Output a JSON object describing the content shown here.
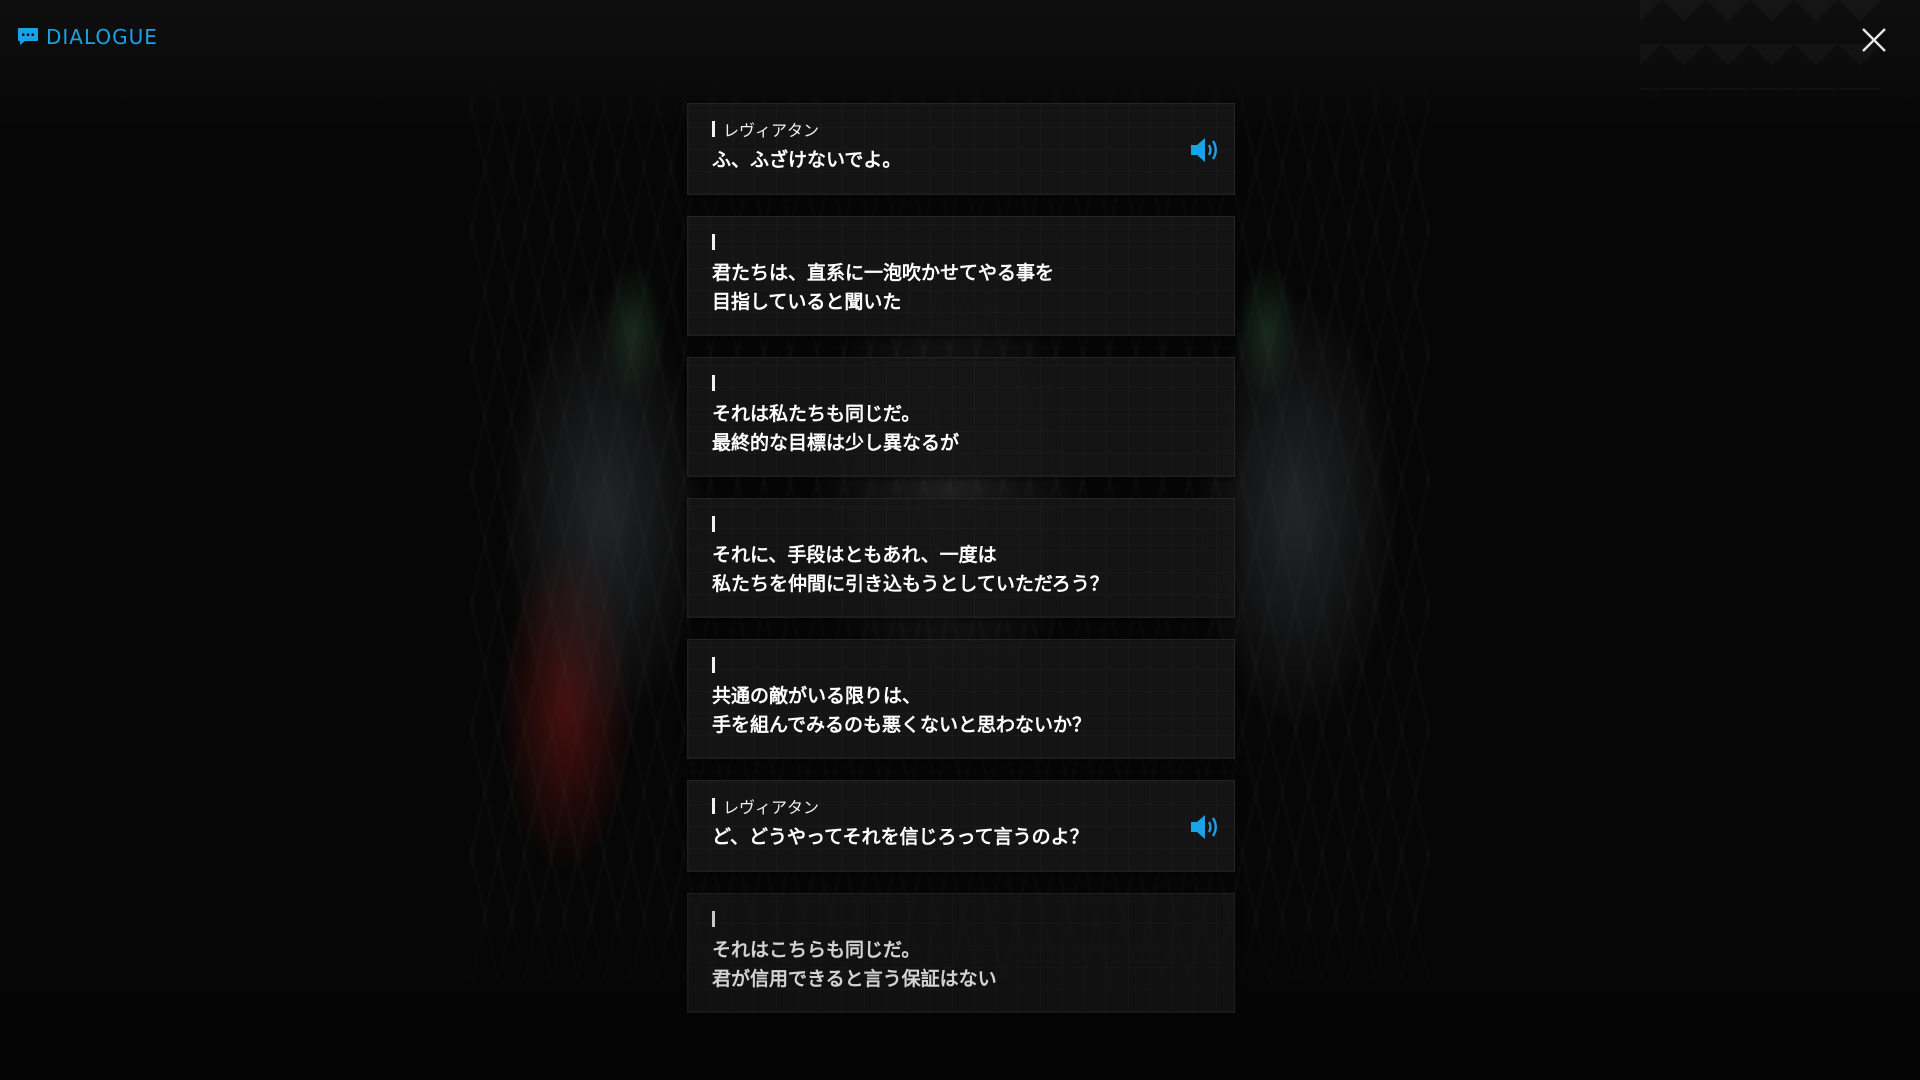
{
  "header": {
    "title": "DIALOGUE",
    "icon": "chat-bubble-icon",
    "close_icon": "close-icon"
  },
  "colors": {
    "accent": "#1aa2e6",
    "card_bg": "#161617",
    "text": "#ffffff",
    "page_bg": "#060606"
  },
  "dialogue": [
    {
      "speaker": "レヴィアタン",
      "lines": [
        "ふ、ふざけないでよ。"
      ],
      "voice": true
    },
    {
      "speaker": "",
      "lines": [
        "君たちは、直系に一泡吹かせてやる事を",
        "目指していると聞いた"
      ],
      "voice": false
    },
    {
      "speaker": "",
      "lines": [
        "それは私たちも同じだ。",
        "最終的な目標は少し異なるが"
      ],
      "voice": false
    },
    {
      "speaker": "",
      "lines": [
        "それに、手段はともあれ、一度は",
        "私たちを仲間に引き込もうとしていただろう？"
      ],
      "voice": false
    },
    {
      "speaker": "",
      "lines": [
        "共通の敵がいる限りは、",
        "手を組んでみるのも悪くないと思わないか？"
      ],
      "voice": false
    },
    {
      "speaker": "レヴィアタン",
      "lines": [
        "ど、どうやってそれを信じろって言うのよ？"
      ],
      "voice": true
    },
    {
      "speaker": "",
      "lines": [
        "それはこちらも同じだ。",
        "君が信用できると言う保証はない"
      ],
      "voice": false
    }
  ]
}
